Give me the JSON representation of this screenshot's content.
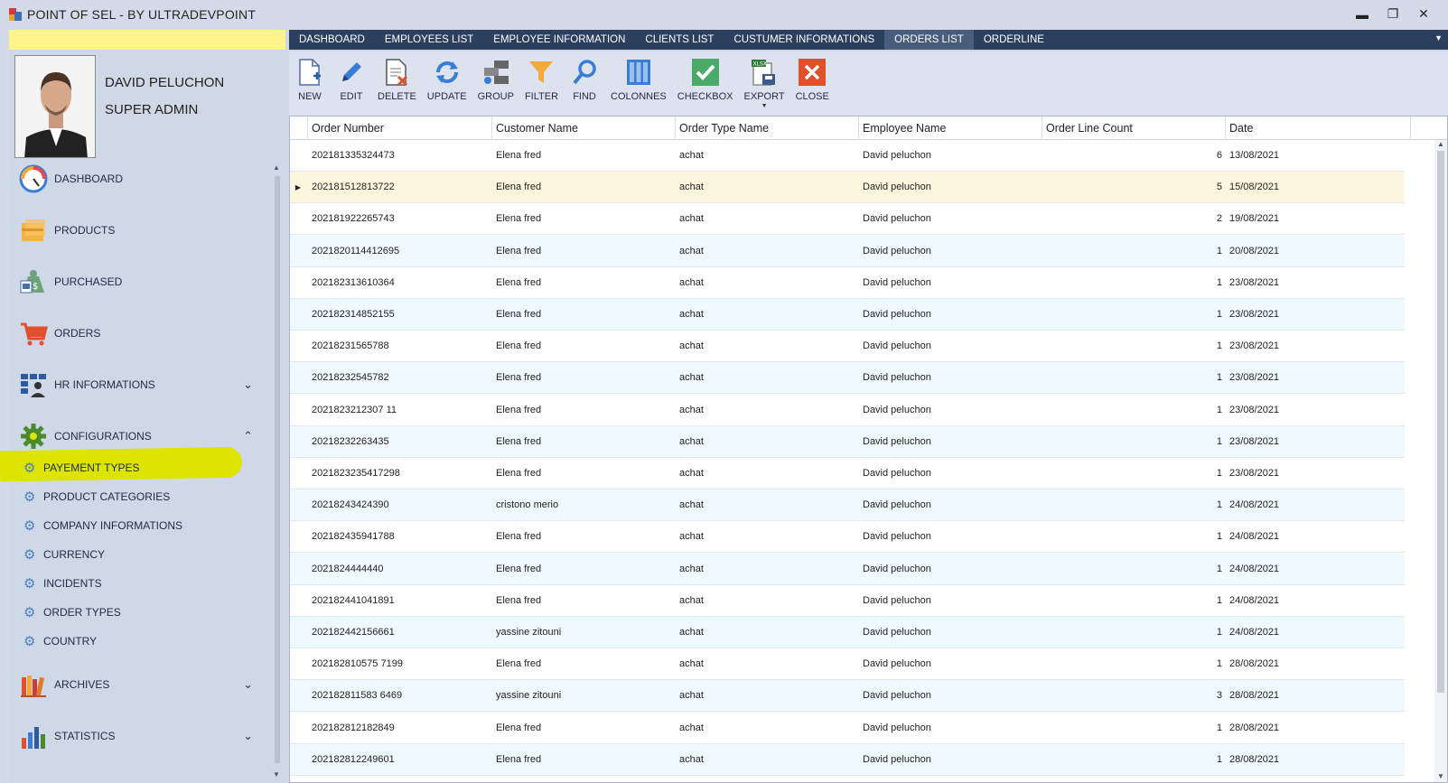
{
  "window": {
    "title": "POINT OF SEL - BY ULTRADEVPOINT",
    "minimize": "▬",
    "restore": "❐",
    "close": "✕"
  },
  "user": {
    "name": "DAVID PELUCHON",
    "role": "SUPER ADMIN"
  },
  "nav": [
    {
      "label": "DASHBOARD",
      "icon": "dashboard-gauge-icon"
    },
    {
      "label": "PRODUCTS",
      "icon": "boxes-icon"
    },
    {
      "label": "PURCHASED",
      "icon": "money-bag-icon"
    },
    {
      "label": "ORDERS",
      "icon": "shopping-cart-icon"
    },
    {
      "label": "HR INFORMATIONS",
      "icon": "hr-team-icon",
      "chevron": "⌄"
    },
    {
      "label": "CONFIGURATIONS",
      "icon": "gear-icon",
      "chevron": "⌃"
    },
    {
      "label": "ARCHIVES",
      "icon": "books-icon",
      "chevron": "⌄"
    },
    {
      "label": "STATISTICS",
      "icon": "bar-chart-icon",
      "chevron": "⌄"
    }
  ],
  "config_items": [
    "PAYEMENT TYPES",
    "PRODUCT CATEGORIES",
    "COMPANY INFORMATIONS",
    "CURRENCY",
    "INCIDENTS",
    "ORDER TYPES",
    "COUNTRY"
  ],
  "tabs": [
    "DASHBOARD",
    "EMPLOYEES LIST",
    "EMPLOYEE INFORMATION",
    "CLIENTS LIST",
    "CUSTUMER INFORMATIONS",
    "ORDERS LIST",
    "ORDERLINE"
  ],
  "active_tab": "ORDERS LIST",
  "toolbar": [
    "NEW",
    "EDIT",
    "DELETE",
    "UPDATE",
    "GROUP",
    "FILTER",
    "FIND",
    "COLONNES",
    "CHECKBOX",
    "EXPORT",
    "CLOSE"
  ],
  "columns": [
    "Order Number",
    "Customer Name",
    "Order Type Name",
    "Employee Name",
    "Order Line Count",
    "Date"
  ],
  "rows": [
    [
      "202181335324473",
      "Elena fred",
      "achat",
      "David peluchon",
      "6",
      "13/08/2021"
    ],
    [
      "202181512813722",
      "Elena fred",
      "achat",
      "David peluchon",
      "5",
      "15/08/2021"
    ],
    [
      "202181922265743",
      "Elena fred",
      "achat",
      "David peluchon",
      "2",
      "19/08/2021"
    ],
    [
      "2021820114412695",
      "Elena fred",
      "achat",
      "David peluchon",
      "1",
      "20/08/2021"
    ],
    [
      "202182313610364",
      "Elena fred",
      "achat",
      "David peluchon",
      "1",
      "23/08/2021"
    ],
    [
      "202182314852155",
      "Elena fred",
      "achat",
      "David peluchon",
      "1",
      "23/08/2021"
    ],
    [
      "20218231565788",
      "Elena fred",
      "achat",
      "David peluchon",
      "1",
      "23/08/2021"
    ],
    [
      "20218232545782",
      "Elena fred",
      "achat",
      "David peluchon",
      "1",
      "23/08/2021"
    ],
    [
      "2021823212307 11",
      "Elena fred",
      "achat",
      "David peluchon",
      "1",
      "23/08/2021"
    ],
    [
      "20218232263435",
      "Elena fred",
      "achat",
      "David peluchon",
      "1",
      "23/08/2021"
    ],
    [
      "2021823235417298",
      "Elena fred",
      "achat",
      "David peluchon",
      "1",
      "23/08/2021"
    ],
    [
      "20218243424390",
      "cristono merio",
      "achat",
      "David peluchon",
      "1",
      "24/08/2021"
    ],
    [
      "202182435941788",
      "Elena fred",
      "achat",
      "David peluchon",
      "1",
      "24/08/2021"
    ],
    [
      "2021824444440",
      "Elena fred",
      "achat",
      "David peluchon",
      "1",
      "24/08/2021"
    ],
    [
      "202182441041891",
      "Elena fred",
      "achat",
      "David peluchon",
      "1",
      "24/08/2021"
    ],
    [
      "202182442156661",
      "yassine zitouni",
      "achat",
      "David peluchon",
      "1",
      "24/08/2021"
    ],
    [
      "202182810575 7199",
      "Elena fred",
      "achat",
      "David peluchon",
      "1",
      "28/08/2021"
    ],
    [
      "202182811583 6469",
      "yassine zitouni",
      "achat",
      "David peluchon",
      "3",
      "28/08/2021"
    ],
    [
      "202182812182849",
      "Elena fred",
      "achat",
      "David peluchon",
      "1",
      "28/08/2021"
    ],
    [
      "202182812249601",
      "Elena fred",
      "achat",
      "David peluchon",
      "1",
      "28/08/2021"
    ]
  ],
  "selected_row": 1
}
